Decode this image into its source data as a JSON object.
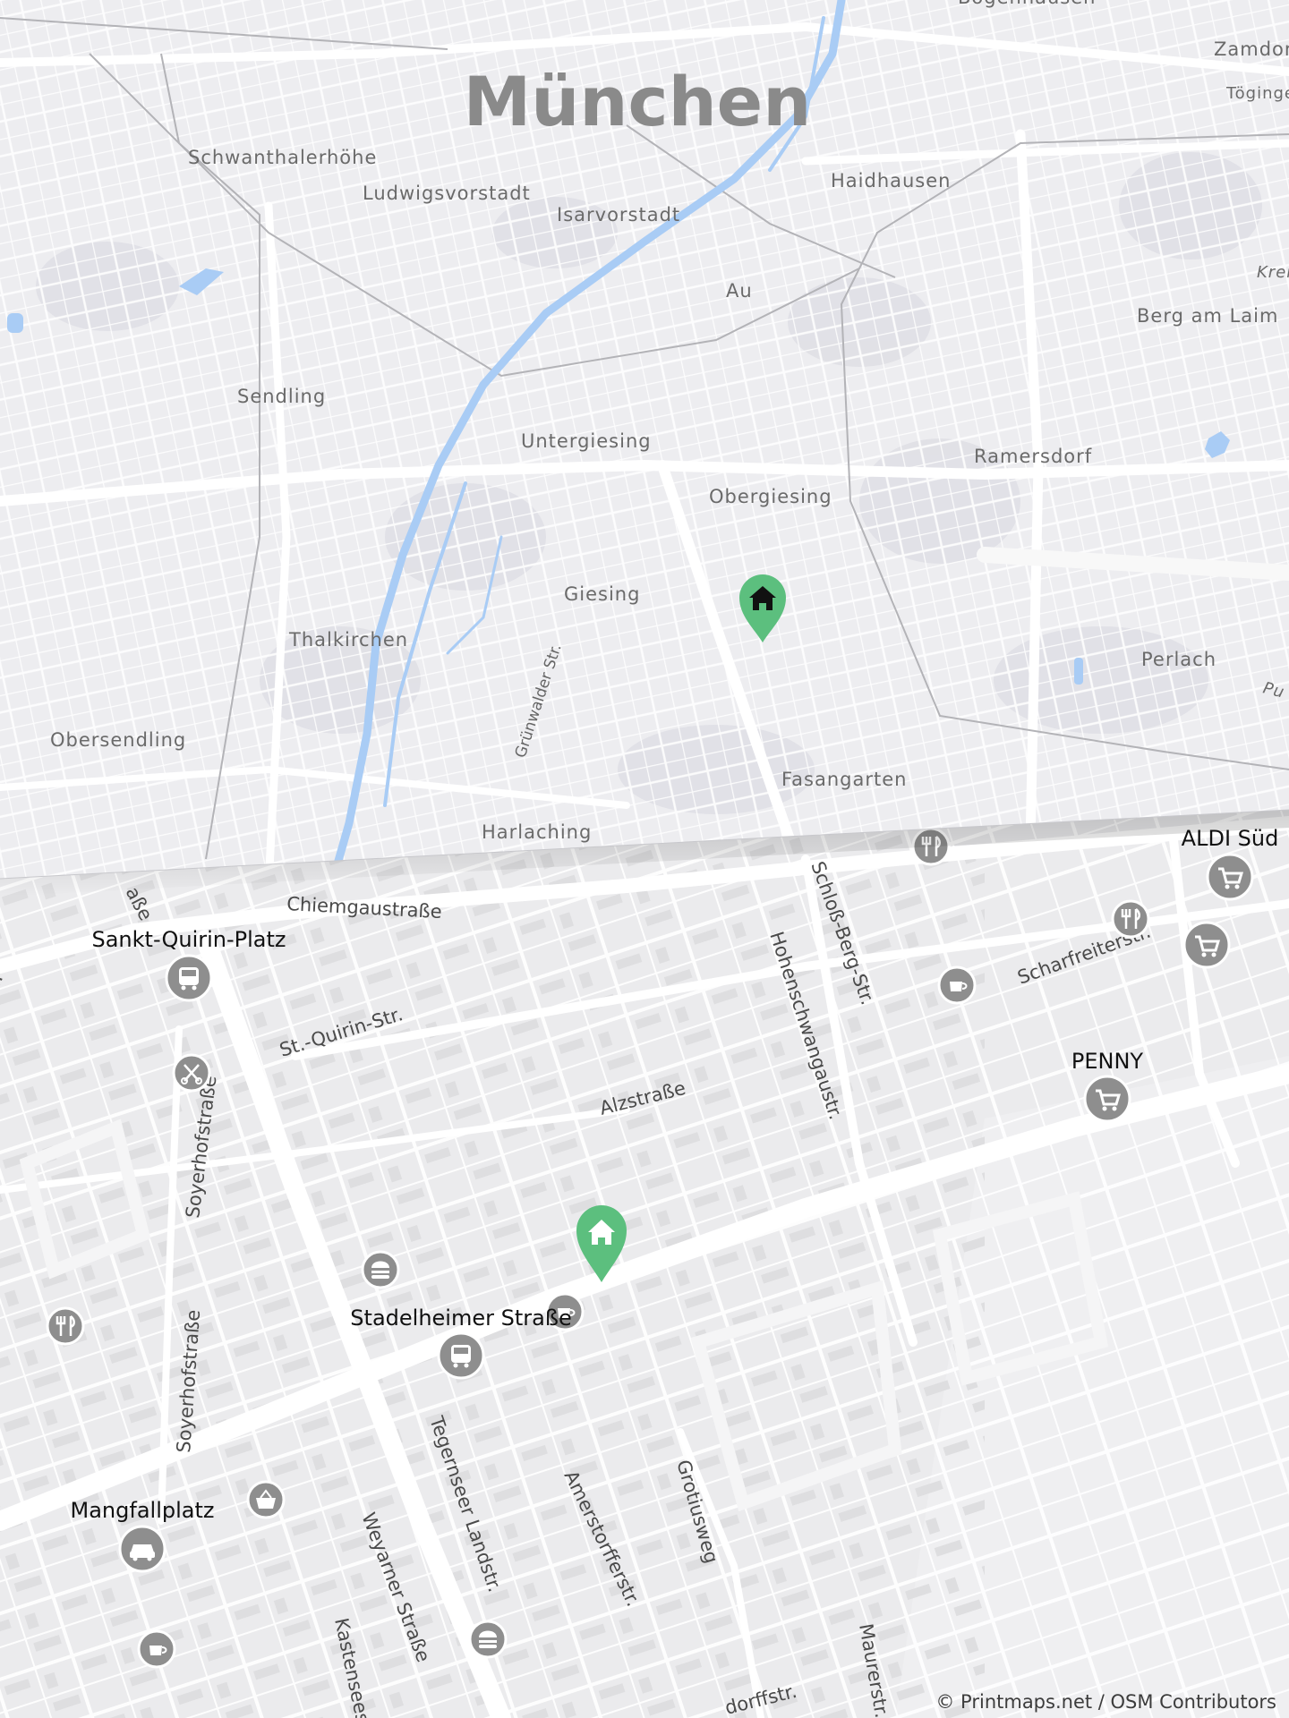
{
  "overview": {
    "city": "München",
    "districts": [
      {
        "name": "Schwanthalerhöhe"
      },
      {
        "name": "Ludwigsvorstadt"
      },
      {
        "name": "Isarvorstadt"
      },
      {
        "name": "Haidhausen"
      },
      {
        "name": "Au"
      },
      {
        "name": "Berg am Laim"
      },
      {
        "name": "Sendling"
      },
      {
        "name": "Untergiesing"
      },
      {
        "name": "Ramersdorf"
      },
      {
        "name": "Obergiesing"
      },
      {
        "name": "Giesing"
      },
      {
        "name": "Thalkirchen"
      },
      {
        "name": "Perlach"
      },
      {
        "name": "Obersendling"
      },
      {
        "name": "Fasangarten"
      },
      {
        "name": "Harlaching"
      },
      {
        "name": "Bogenhausen"
      },
      {
        "name": "Zamdorf"
      },
      {
        "name": "Töginge"
      },
      {
        "name": "Krei"
      },
      {
        "name": "Pu"
      }
    ],
    "streets": [
      {
        "name": "Grünwalder Str."
      }
    ],
    "home_marker_icon": "home-icon"
  },
  "detail": {
    "streets": [
      {
        "name": "Chiemgaustraße"
      },
      {
        "name": "St.-Quirin-Str."
      },
      {
        "name": "Alzstraße"
      },
      {
        "name": "Hohenschwangaustr."
      },
      {
        "name": "Schloß-Berg-Str."
      },
      {
        "name": "Scharfreiterstr."
      },
      {
        "name": "Soyerhofstraße"
      },
      {
        "name": "Soyerhofstraße"
      },
      {
        "name": "Tegernseer Landstr."
      },
      {
        "name": "Weyarner Straße"
      },
      {
        "name": "Kastenseestr."
      },
      {
        "name": "Amerstorfferstr."
      },
      {
        "name": "Grotiusweg"
      },
      {
        "name": "Maurerstr."
      },
      {
        "name": "dorffstr."
      },
      {
        "name": "aße"
      },
      {
        "name": "tr."
      }
    ],
    "pois": [
      {
        "name": "Sankt-Quirin-Platz",
        "icon": "bus-icon"
      },
      {
        "name": "Stadelheimer Straße",
        "icon": "bus-icon"
      },
      {
        "name": "Mangfallplatz",
        "icon": "car-icon"
      },
      {
        "name": "ALDI Süd",
        "icon": "cart-icon"
      },
      {
        "name": "PENNY",
        "icon": "cart-icon"
      }
    ],
    "unlabeled_icons": [
      "restaurant-icon",
      "restaurant-icon",
      "restaurant-icon",
      "cart-icon",
      "cafe-icon",
      "hairdresser-icon",
      "fastfood-icon",
      "cafe-icon",
      "basket-icon",
      "fastfood-icon",
      "cafe-icon"
    ],
    "home_marker_icon": "home-icon"
  },
  "colors": {
    "water": "#a9ccf5",
    "marker": "#5cbf7e",
    "poi_icon_bg": "#8e8e8e",
    "road": "#ffffff",
    "land": "#ebebed"
  },
  "credit": "© Printmaps.net / OSM Contributors"
}
